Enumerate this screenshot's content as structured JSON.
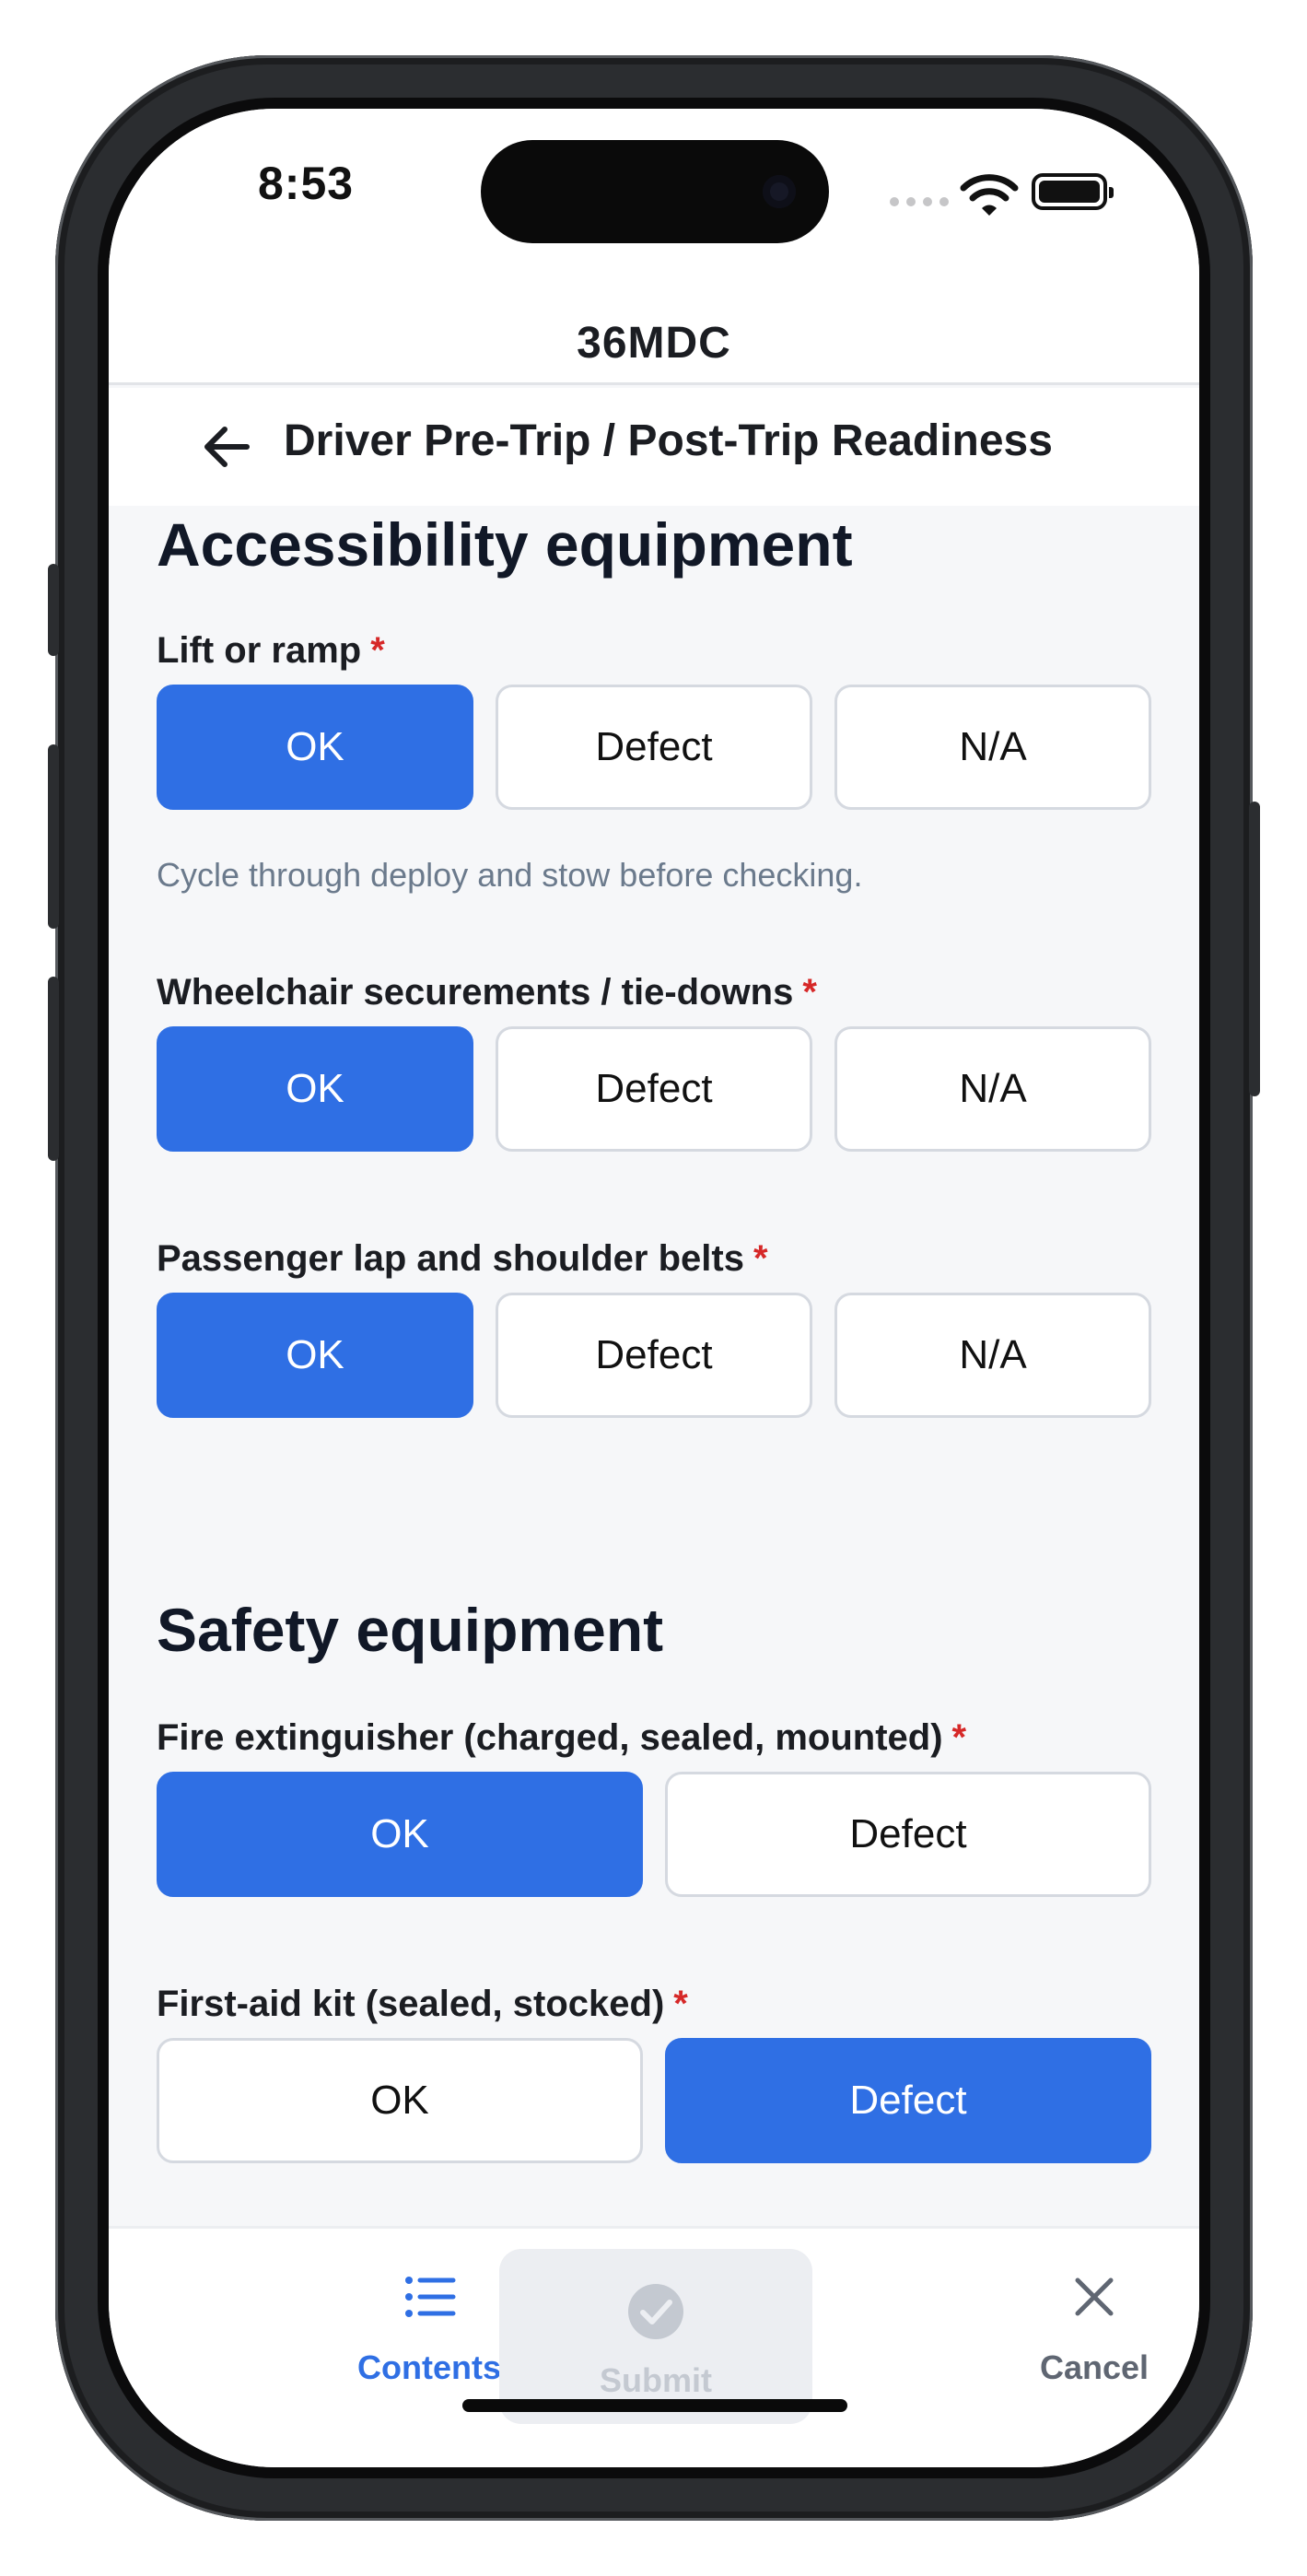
{
  "status_bar": {
    "time": "8:53"
  },
  "app": {
    "title": "36MDC"
  },
  "nav": {
    "title": "Driver Pre-Trip / Post-Trip Readiness"
  },
  "sections": [
    {
      "title": "Accessibility equipment",
      "questions": [
        {
          "label": "Lift or ramp",
          "required_mark": "*",
          "options": [
            "OK",
            "Defect",
            "N/A"
          ],
          "selected": "OK",
          "hint": "Cycle through deploy and stow before checking."
        },
        {
          "label": "Wheelchair securements / tie-downs",
          "required_mark": "*",
          "options": [
            "OK",
            "Defect",
            "N/A"
          ],
          "selected": "OK"
        },
        {
          "label": "Passenger lap and shoulder belts",
          "required_mark": "*",
          "options": [
            "OK",
            "Defect",
            "N/A"
          ],
          "selected": "OK"
        }
      ]
    },
    {
      "title": "Safety equipment",
      "questions": [
        {
          "label": "Fire extinguisher (charged, sealed, mounted)",
          "required_mark": "*",
          "options": [
            "OK",
            "Defect"
          ],
          "selected": "OK"
        },
        {
          "label": "First-aid kit (sealed, stocked)",
          "required_mark": "*",
          "options": [
            "OK",
            "Defect"
          ],
          "selected": "Defect"
        }
      ]
    }
  ],
  "tabbar": {
    "contents": {
      "label": "Contents",
      "icon": "list-icon"
    },
    "submit": {
      "label": "Submit",
      "icon": "check-circle-icon",
      "disabled": true
    },
    "cancel": {
      "label": "Cancel",
      "icon": "close-icon"
    }
  },
  "colors": {
    "accent": "#2f6fe4",
    "required": "#d62828",
    "hint": "#6b7a8c"
  }
}
